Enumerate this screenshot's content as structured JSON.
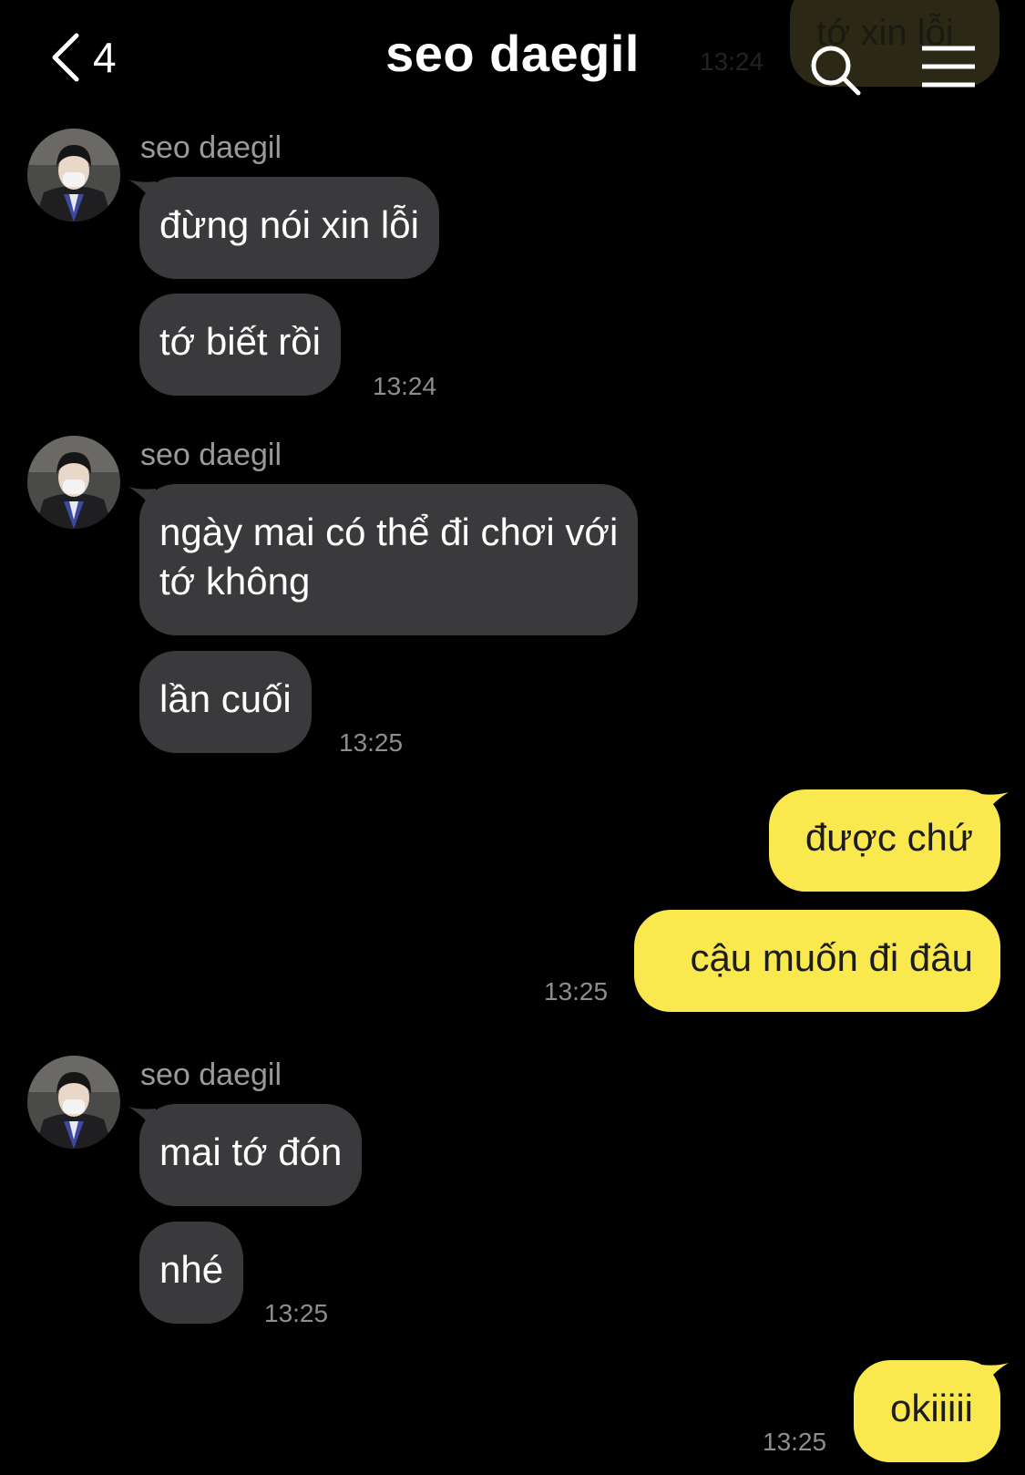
{
  "header": {
    "back_count": "4",
    "title": "seo daegil",
    "ghost_message": "tớ xin lỗi",
    "ghost_time": "13:24",
    "icons": {
      "back": "chevron-left-icon",
      "search": "search-icon",
      "menu": "menu-icon"
    }
  },
  "colors": {
    "background": "#000000",
    "incoming_bubble": "#3a3a3c",
    "outgoing_bubble": "#f9e94e",
    "timestamp": "#8e8e8e"
  },
  "messages": {
    "group1": {
      "sender": "seo daegil",
      "bubbles": [
        "đừng nói xin lỗi",
        "tớ biết rồi"
      ],
      "time": "13:24"
    },
    "group2": {
      "sender": "seo daegil",
      "bubbles": [
        "ngày mai có thể đi chơi với tớ không",
        "lần cuối"
      ],
      "bubble1_line1": "ngày mai có thể đi chơi với",
      "bubble1_line2": "tớ không",
      "time": "13:25"
    },
    "group3": {
      "bubbles": [
        "được chứ",
        "cậu muốn đi đâu"
      ],
      "time": "13:25"
    },
    "group4": {
      "sender": "seo daegil",
      "bubbles": [
        "mai tớ đón",
        "nhé"
      ],
      "time": "13:25"
    },
    "group5": {
      "bubbles": [
        "okiiiii"
      ],
      "time": "13:25"
    }
  }
}
